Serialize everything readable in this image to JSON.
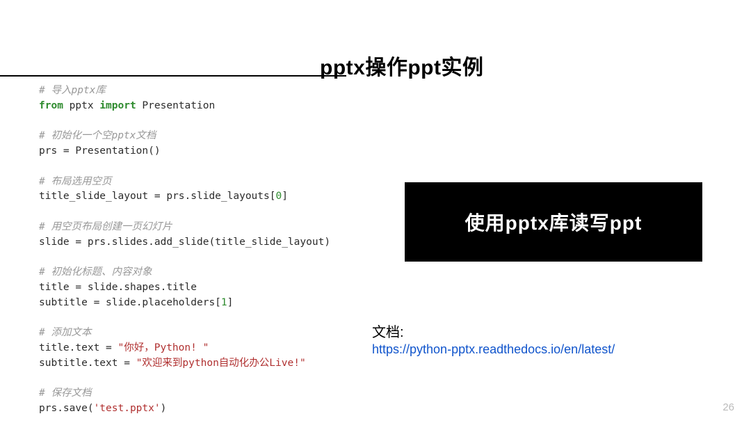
{
  "title": "pptx操作ppt实例",
  "code": {
    "c1": "# 导入pptx库",
    "l1_kw_from": "from",
    "l1_mod": " pptx ",
    "l1_kw_import": "import",
    "l1_name": " Presentation",
    "c2": "# 初始化一个空pptx文档",
    "l2_var": "prs ",
    "l2_eq": "=",
    "l2_call": " Presentation()",
    "c3": "# 布局选用空页",
    "l3_lhs": "title_slide_layout ",
    "l3_eq": "=",
    "l3_rhs_a": " prs.slide_layouts[",
    "l3_zero": "0",
    "l3_rhs_b": "]",
    "c4": "# 用空页布局创建一页幻灯片",
    "l4_lhs": "slide ",
    "l4_eq": "=",
    "l4_rhs": " prs.slides.add_slide(title_slide_layout)",
    "c5": "# 初始化标题、内容对象",
    "l5a_lhs": "title ",
    "l5a_eq": "=",
    "l5a_rhs": " slide.shapes.title",
    "l5b_lhs": "subtitle ",
    "l5b_eq": "=",
    "l5b_rhs_a": " slide.placeholders[",
    "l5b_one": "1",
    "l5b_rhs_b": "]",
    "c6": "# 添加文本",
    "l6a_lhs": "title.text ",
    "l6a_eq": "=",
    "l6a_sp": " ",
    "l6a_str": "\"你好，Python! \"",
    "l6b_lhs": "subtitle.text ",
    "l6b_eq": "=",
    "l6b_sp": " ",
    "l6b_str": "\"欢迎来到python自动化办公Live!\"",
    "c7": "# 保存文档",
    "l7_lhs": "prs.save(",
    "l7_str": "'test.pptx'",
    "l7_rhs": ")"
  },
  "box_text": "使用pptx库读写ppt",
  "doc_label": "文档:",
  "doc_url": "https://python-pptx.readthedocs.io/en/latest/",
  "page_number": "26"
}
